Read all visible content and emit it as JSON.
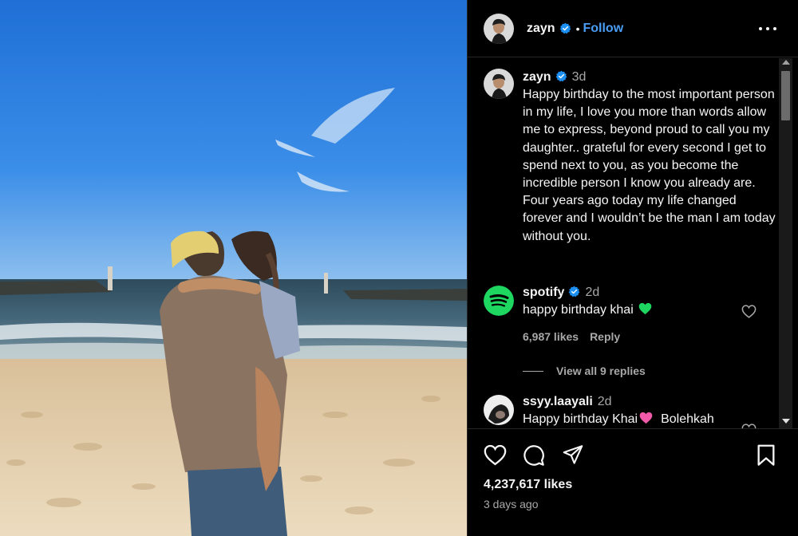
{
  "post": {
    "username": "zayn",
    "dot": "•",
    "follow_label": "Follow"
  },
  "caption": {
    "username": "zayn",
    "time": "3d",
    "text": "Happy birthday to the most important person in my life, I love you more than words allow me to express, beyond proud to call you my daughter.. grateful for every second I get to spend next to you, as you become the incredible person I know you already are. Four years ago today my life changed forever and I wouldn’t be the man I am today without you."
  },
  "comments": [
    {
      "username": "spotify",
      "time": "2d",
      "text": "happy birthday khai",
      "likes": "6,987 likes",
      "reply_label": "Reply",
      "view_replies": "View all 9 replies"
    },
    {
      "username": "ssyy.laayali",
      "time": "2d",
      "text": "Happy birthday Khai",
      "text_after": "Bolehkah"
    }
  ],
  "footer": {
    "likes": "4,237,617 likes",
    "posted": "3 days ago"
  },
  "colors": {
    "background": "#000000",
    "link_blue": "#4a9df5",
    "verified_blue": "#1d8ff2",
    "spotify_green": "#1ed760",
    "muted_text": "#a8a8a8"
  },
  "icons": [
    "verified-icon",
    "more-options-icon",
    "heart-icon",
    "comment-icon",
    "share-icon",
    "bookmark-icon",
    "green-heart-emoji",
    "pink-heart-emoji"
  ]
}
